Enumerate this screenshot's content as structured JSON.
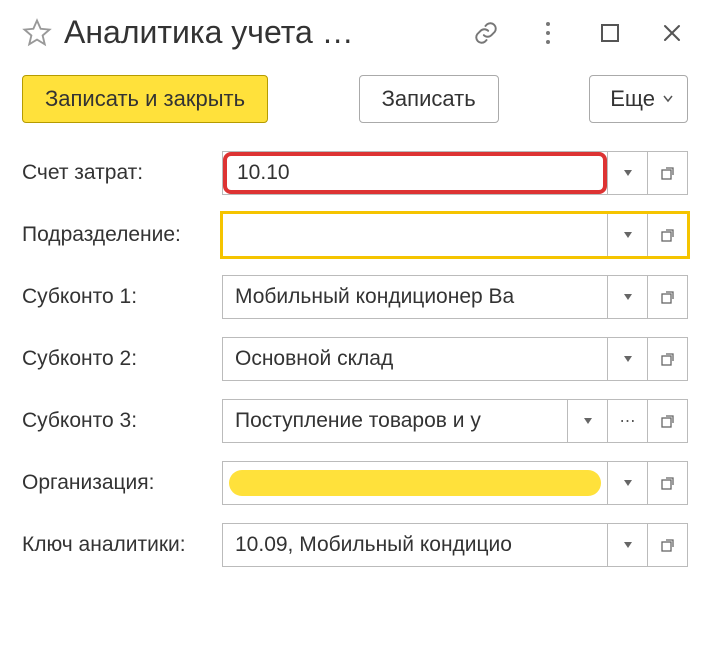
{
  "title": "Аналитика учета …",
  "toolbar": {
    "save_close": "Записать и закрыть",
    "save": "Записать",
    "more": "Еще"
  },
  "fields": {
    "cost_account": {
      "label": "Счет затрат:",
      "value": "10.10"
    },
    "division": {
      "label": "Подразделение:",
      "value": ""
    },
    "subkonto1": {
      "label": "Субконто 1:",
      "value": "Мобильный кондиционер Ва"
    },
    "subkonto2": {
      "label": "Субконто 2:",
      "value": "Основной склад"
    },
    "subkonto3": {
      "label": "Субконто 3:",
      "value": "Поступление товаров и у"
    },
    "organization": {
      "label": "Организация:",
      "value": ""
    },
    "analytics_key": {
      "label": "Ключ аналитики:",
      "value": "10.09, Мобильный кондицио"
    }
  },
  "icons": {
    "dots": "⋯"
  }
}
